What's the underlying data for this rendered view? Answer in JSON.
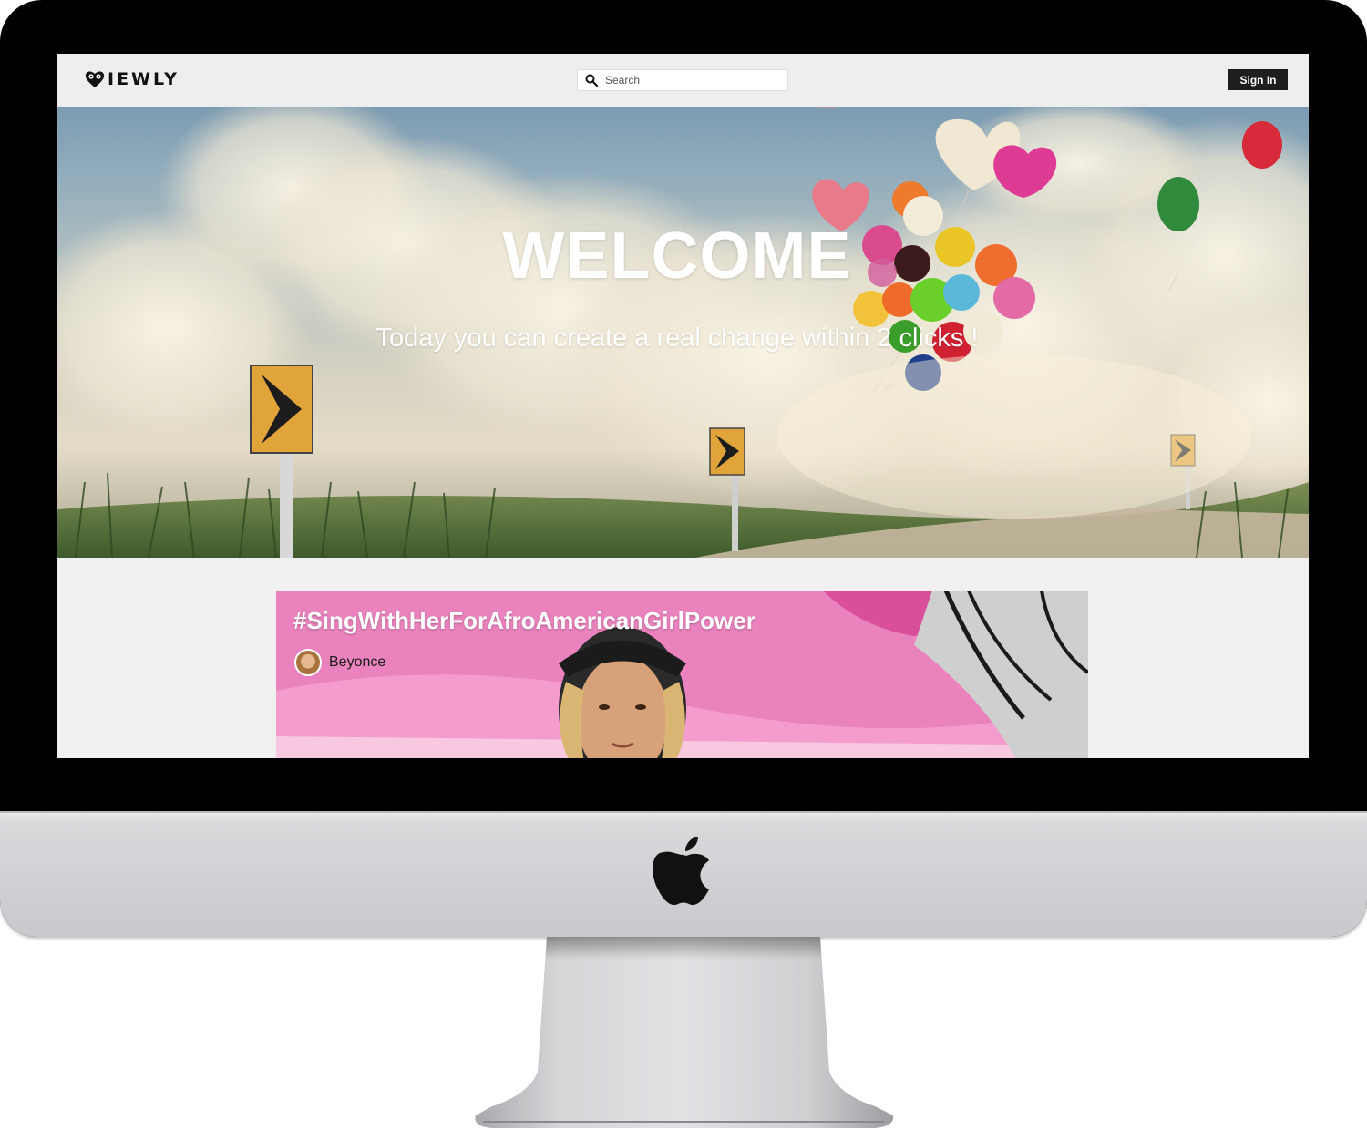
{
  "app": {
    "logo_text": "IEWLY",
    "logo_icon": "heart-glasses-icon"
  },
  "navbar": {
    "search_placeholder": "Search",
    "search_icon": "search-icon",
    "signin_label": "Sign In"
  },
  "hero": {
    "title": "WELCOME",
    "subtitle": "Today you can create a real change within 2 clicks !"
  },
  "feed": {
    "cards": [
      {
        "title": "#SingWithHerForAfroAmericanGirlPower",
        "author": "Beyonce"
      }
    ]
  },
  "colors": {
    "signin_bg": "#1e1e1e",
    "navbar_bg": "#eceef0",
    "card_accent": "#e07fb6"
  }
}
